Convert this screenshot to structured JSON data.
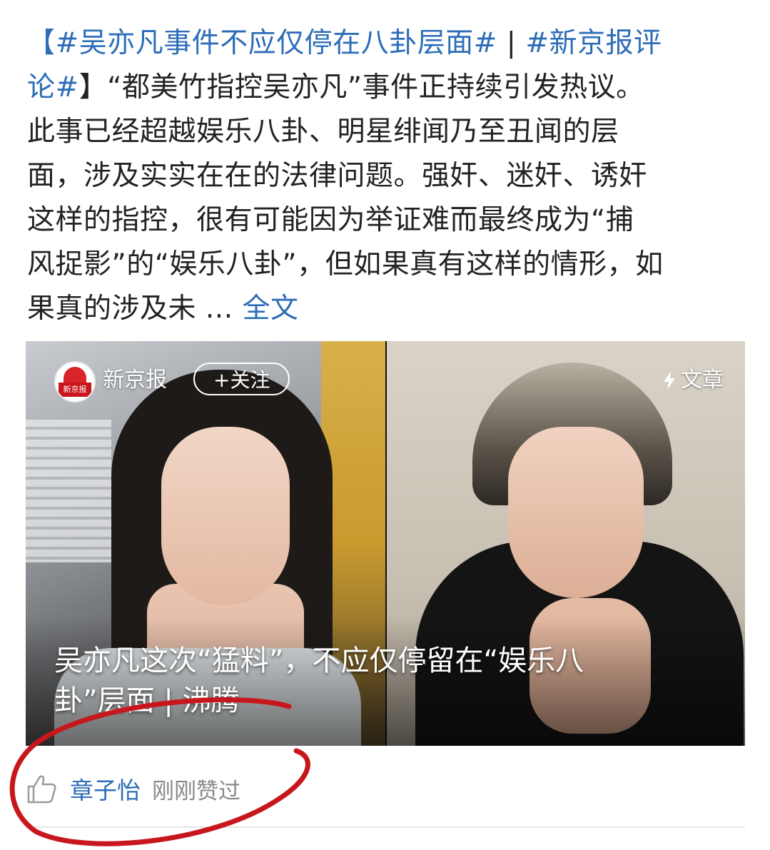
{
  "post": {
    "line1": {
      "bracket_open": "【",
      "topic1": "#吴亦凡事件不应仅停在八卦层面#",
      "separator": " | ",
      "topic2_part1": "#新京报评"
    },
    "line2": {
      "topic2_part2": "论#",
      "bracket_close": "】",
      "text": "“都美竹指控吴亦凡”事件正持续引发热议。"
    },
    "line3": "此事已经超越娱乐八卦、明星绯闻乃至丑闻的层",
    "line4": "面，涉及实实在在的法律问题。强奸、迷奸、诱奸",
    "line5": "这样的指控，很有可能因为举证难而最终成为“捕",
    "line6": "风捉影”的“娱乐八卦”，但如果真有这样的情形，如",
    "line7": {
      "text": "果真的涉及未 ... ",
      "full_link": "全文"
    }
  },
  "card": {
    "source_name": "新京报",
    "source_logo_text": "新京报",
    "follow_label": "+关注",
    "article_tag": "文章",
    "title_line1": "吴亦凡这次“猛料”，不应仅停留在“娱乐八",
    "title_line2": "卦”层面 | 沸腾"
  },
  "like": {
    "icon": "thumbs-up-icon",
    "user": "章子怡",
    "time_text": "刚刚赞过"
  },
  "colors": {
    "link": "#2d6db8",
    "text": "#222222",
    "muted": "#888888",
    "annotation": "#c8161d"
  }
}
